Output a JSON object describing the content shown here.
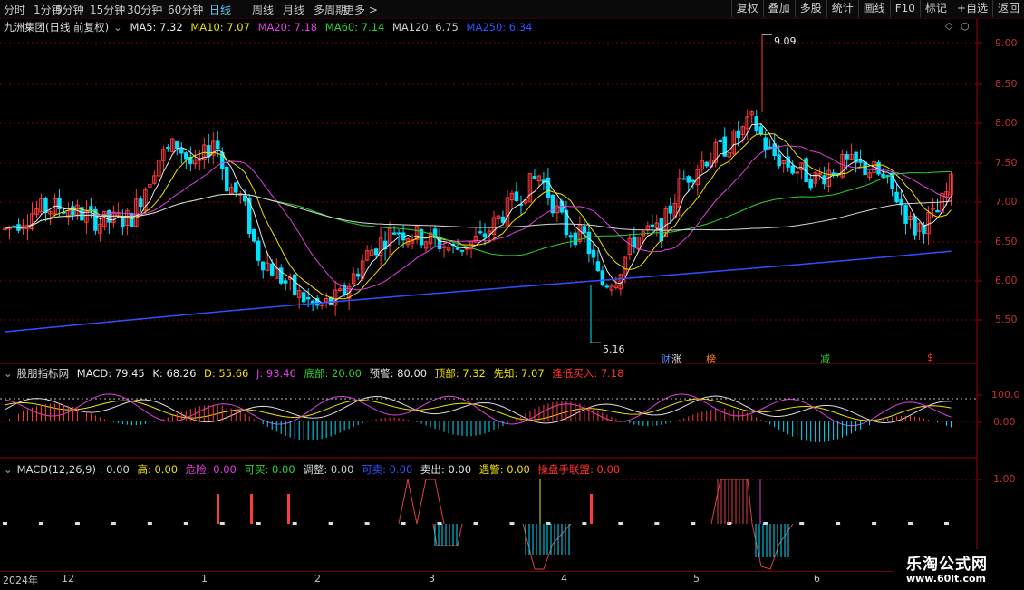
{
  "periods": [
    {
      "label": "分时",
      "active": false
    },
    {
      "label": "1分钟",
      "active": false
    },
    {
      "label": "5分钟",
      "active": false
    },
    {
      "label": "15分钟",
      "active": false
    },
    {
      "label": "30分钟",
      "active": false
    },
    {
      "label": "60分钟",
      "active": false
    },
    {
      "label": "日线",
      "active": true
    },
    {
      "label": "周线",
      "active": false
    },
    {
      "label": "月线",
      "active": false
    },
    {
      "label": "多周期",
      "active": false
    },
    {
      "label": "更多 >",
      "active": false
    }
  ],
  "tools": [
    "复权",
    "叠加",
    "多股",
    "统计",
    "画线",
    "F10",
    "标记",
    "+自选",
    "返回"
  ],
  "main": {
    "title": "九洲集团(日线 前复权)",
    "ma": [
      {
        "label": "MA5: 7.32",
        "color": "#e8e8e8"
      },
      {
        "label": "MA10: 7.07",
        "color": "#f0e000"
      },
      {
        "label": "MA20: 7.18",
        "color": "#e040e0"
      },
      {
        "label": "MA60: 7.14",
        "color": "#30d030"
      },
      {
        "label": "MA120: 6.75",
        "color": "#d0d0d0"
      },
      {
        "label": "MA250: 6.34",
        "color": "#3050ff"
      }
    ],
    "yticks": [
      "9.00",
      "8.50",
      "8.00",
      "7.50",
      "7.00",
      "6.50",
      "6.00",
      "5.50"
    ],
    "high_label": "9.09",
    "low_label": "5.16",
    "markers": [
      {
        "text": "财",
        "color": "#5090ff"
      },
      {
        "text": "涨",
        "color": "#e0e0e0"
      },
      {
        "text": "榜",
        "color": "#ff8020"
      },
      {
        "text": "减",
        "color": "#30d030"
      },
      {
        "text": "$",
        "color": "#ff3030"
      }
    ]
  },
  "ind1": {
    "title": "股朋指标网",
    "items": [
      {
        "label": "MACD: 79.45",
        "color": "#e8e8e8"
      },
      {
        "label": "K: 68.26",
        "color": "#e8e8e8"
      },
      {
        "label": "D: 55.66",
        "color": "#f0e000"
      },
      {
        "label": "J: 93.46",
        "color": "#e040e0"
      },
      {
        "label": "底部: 20.00",
        "color": "#30d030"
      },
      {
        "label": "预警: 80.00",
        "color": "#e8e8e8"
      },
      {
        "label": "顶部: 7.32",
        "color": "#f0e000"
      },
      {
        "label": "先知: 7.07",
        "color": "#f0e000"
      },
      {
        "label": "逢低买入: 7.18",
        "color": "#ff3030"
      }
    ],
    "yticks": [
      "100.0",
      "0.00"
    ]
  },
  "ind2": {
    "title": "MACD(12,26,9) : 0.00",
    "items": [
      {
        "label": "高: 0.00",
        "color": "#f0e000"
      },
      {
        "label": "危险: 0.00",
        "color": "#e040e0"
      },
      {
        "label": "可买: 0.00",
        "color": "#30d030"
      },
      {
        "label": "调整: 0.00",
        "color": "#d0d0d0"
      },
      {
        "label": "可卖: 0.00",
        "color": "#3050ff"
      },
      {
        "label": "卖出: 0.00",
        "color": "#e8e8e8"
      },
      {
        "label": "遇警: 0.00",
        "color": "#f0e000"
      },
      {
        "label": "操盘手联盟: 0.00",
        "color": "#ff3030"
      }
    ],
    "yticks": [
      "1.00"
    ]
  },
  "timeaxis": [
    "2024年",
    "12",
    "1",
    "2",
    "3",
    "4",
    "5",
    "6"
  ],
  "watermark": {
    "line1": "乐淘公式网",
    "line2": "www.60lt.com"
  },
  "colors": {
    "up": "#ff3c3c",
    "down": "#00e0ff",
    "grid": "#7a0000"
  }
}
